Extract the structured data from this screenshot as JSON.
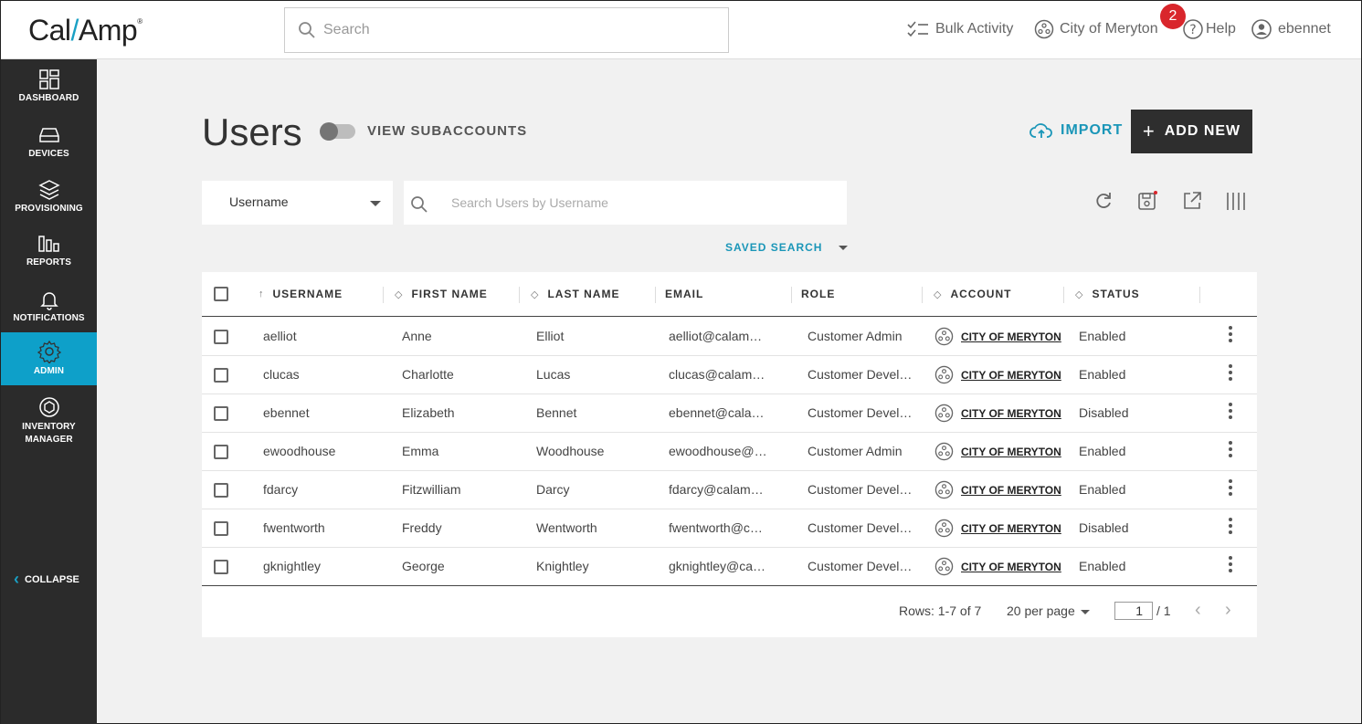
{
  "brand": {
    "name_a": "Cal",
    "name_b": "Amp",
    "tm": "®"
  },
  "search": {
    "placeholder": "Search"
  },
  "topnav": {
    "bulk": "Bulk Activity",
    "account": "City of Meryton",
    "badge": "2",
    "help": "Help",
    "user": "ebennet"
  },
  "sidebar": {
    "items": [
      {
        "label": "DASHBOARD"
      },
      {
        "label": "DEVICES"
      },
      {
        "label": "PROVISIONING"
      },
      {
        "label": "REPORTS"
      },
      {
        "label": "NOTIFICATIONS"
      },
      {
        "label": "ADMIN"
      },
      {
        "label": "INVENTORY MANAGER"
      }
    ],
    "collapse": "COLLAPSE"
  },
  "page": {
    "title": "Users",
    "toggle_label": "VIEW SUBACCOUNTS",
    "import": "IMPORT",
    "add_new": "ADD NEW"
  },
  "filter": {
    "field": "Username",
    "placeholder": "Search Users by Username",
    "saved_search": "SAVED SEARCH"
  },
  "table": {
    "columns": [
      "USERNAME",
      "FIRST NAME",
      "LAST NAME",
      "EMAIL",
      "ROLE",
      "ACCOUNT",
      "STATUS"
    ],
    "rows": [
      {
        "username": "aelliot",
        "first": "Anne",
        "last": "Elliot",
        "email": "aelliot@calam…",
        "role": "Customer Admin",
        "account": "CITY OF MERYTON",
        "status": "Enabled"
      },
      {
        "username": "clucas",
        "first": "Charlotte",
        "last": "Lucas",
        "email": "clucas@calam…",
        "role": "Customer Devel…",
        "account": "CITY OF MERYTON",
        "status": "Enabled"
      },
      {
        "username": "ebennet",
        "first": "Elizabeth",
        "last": "Bennet",
        "email": "ebennet@cala…",
        "role": "Customer Devel…",
        "account": "CITY OF MERYTON",
        "status": "Disabled"
      },
      {
        "username": "ewoodhouse",
        "first": "Emma",
        "last": "Woodhouse",
        "email": "ewoodhouse@…",
        "role": "Customer Admin",
        "account": "CITY OF MERYTON",
        "status": "Enabled"
      },
      {
        "username": "fdarcy",
        "first": "Fitzwilliam",
        "last": "Darcy",
        "email": "fdarcy@calam…",
        "role": "Customer Devel…",
        "account": "CITY OF MERYTON",
        "status": "Enabled"
      },
      {
        "username": "fwentworth",
        "first": "Freddy",
        "last": "Wentworth",
        "email": "fwentworth@c…",
        "role": "Customer Devel…",
        "account": "CITY OF MERYTON",
        "status": "Disabled"
      },
      {
        "username": "gknightley",
        "first": "George",
        "last": "Knightley",
        "email": "gknightley@ca…",
        "role": "Customer Devel…",
        "account": "CITY OF MERYTON",
        "status": "Enabled"
      }
    ]
  },
  "pagination": {
    "rows": "Rows: 1-7 of 7",
    "per_page": "20 per page",
    "page": "1",
    "total": "/ 1"
  },
  "colors": {
    "accent": "#0ea0c9",
    "sidebar": "#2b2b2b",
    "badge": "#d9262c",
    "primary_button": "#2e2e2e"
  }
}
